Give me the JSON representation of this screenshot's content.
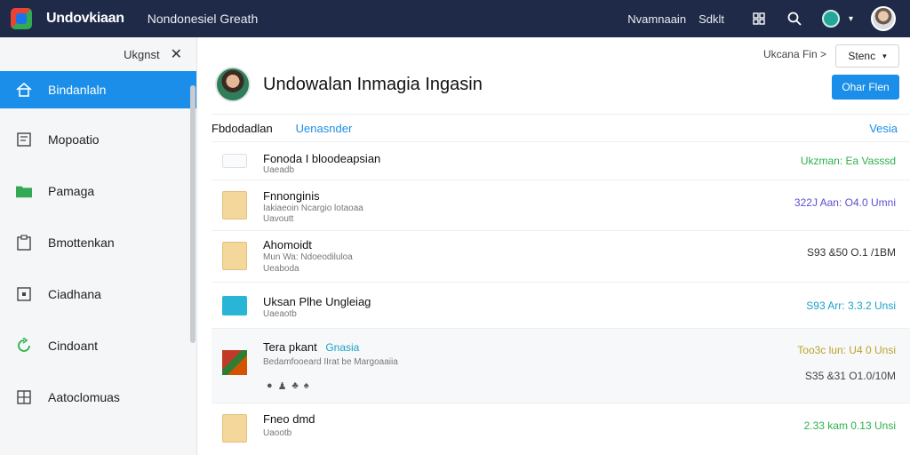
{
  "header": {
    "app_name": "Undovkiaan",
    "subtitle": "Nondonesiel Greath",
    "links": [
      "Nvamnaain",
      "Sdklt"
    ],
    "icons": [
      "app-grid-icon",
      "search-icon",
      "profile-status-icon",
      "chevron-down-icon",
      "user-avatar"
    ]
  },
  "sidebar": {
    "header_label": "Ukgnst",
    "items": [
      {
        "label": "Bindanlaln",
        "icon": "home-icon",
        "active": true
      },
      {
        "label": "Mopoatio",
        "icon": "document-icon",
        "active": false
      },
      {
        "label": "Pamaga",
        "icon": "green-folder-icon",
        "active": false
      },
      {
        "label": "Bmottenkan",
        "icon": "clipboard-icon",
        "active": false
      },
      {
        "label": "Ciadhana",
        "icon": "square-icon",
        "active": false
      },
      {
        "label": "Cindoant",
        "icon": "refresh-icon",
        "active": false
      },
      {
        "label": "Aatoclomuas",
        "icon": "grid-icon",
        "active": false
      }
    ]
  },
  "main": {
    "crumb": "Ukcana  Fin  >",
    "sort_label": "Stenc",
    "title": "Undowalan Inmagia Ingasin",
    "primary_button": "Ohar Flen",
    "tabs": [
      "Fbdodadlan",
      "Uenasnder"
    ],
    "tab_right": "Vesia",
    "rows": [
      {
        "type": "pill",
        "title": "Fonoda I bloodeapsian",
        "sub": "Uaeadb",
        "sub2": "",
        "meta": "Ukzman: Ea Vasssd",
        "meta_color": "#2bb24c",
        "meta2": ""
      },
      {
        "type": "folder",
        "title": "Fnnonginis",
        "sub": "Iakiaeoin Ncargio lotaoaa",
        "sub2": "Uavoutt",
        "meta": "322J Aan:  O4.0 Umni",
        "meta_color": "#5b4fd6",
        "meta2": ""
      },
      {
        "type": "folder",
        "title": "Ahomoidt",
        "sub": "Mun Wa: Ndoeodiluloa",
        "sub2": "Ueaboda",
        "meta": "S93 &50 O.1 /1BM",
        "meta_color": "#333333",
        "meta2": ""
      },
      {
        "type": "folder-blue",
        "title": "Uksan Plhe Ungleiag",
        "sub": "Uaeaotb",
        "sub2": "",
        "meta": "S93 Arr:  3.3.2 Unsi",
        "meta_color": "#1ba0c8",
        "meta2": ""
      },
      {
        "type": "thumb",
        "title": "Tera pkant",
        "title_link": "Gnasia",
        "sub": "Bedamfooeard IIrat be Margoaaiia",
        "sub2": "",
        "meta": "Too3c lun:  U4 0 Unsi",
        "meta_color": "#b9a42a",
        "meta2": "S35 &31 O1.0/10M"
      },
      {
        "type": "folder",
        "title": "Fneo dmd",
        "sub": "Uaootb",
        "sub2": "",
        "meta": "2.33 kam  0.13 Unsi",
        "meta_color": "#2bb24c",
        "meta2": ""
      }
    ],
    "mini_icons": [
      "●",
      "♟",
      "♣",
      "♠"
    ]
  }
}
